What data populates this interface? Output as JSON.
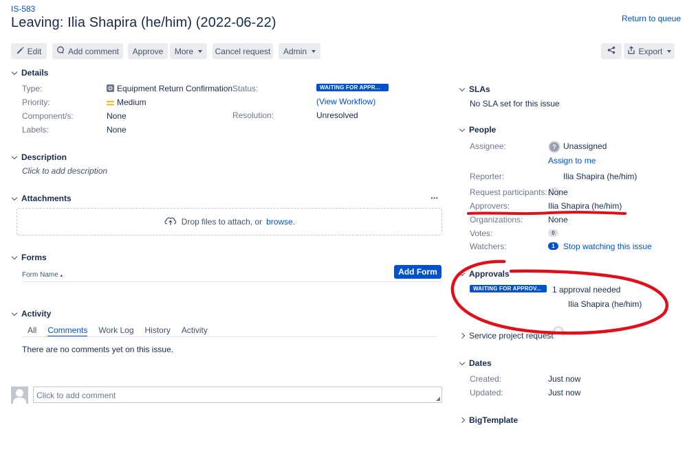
{
  "header": {
    "issue_key": "IS-583",
    "title": "Leaving: Ilia Shapira (he/him) (2022-06-22)",
    "return_link": "Return to queue"
  },
  "toolbar": {
    "edit": "Edit",
    "add_comment": "Add comment",
    "approve": "Approve",
    "more": "More",
    "cancel_request": "Cancel request",
    "admin": "Admin",
    "export": "Export"
  },
  "details": {
    "heading": "Details",
    "type_label": "Type:",
    "type_value": "Equipment Return Confirmation",
    "priority_label": "Priority:",
    "priority_value": "Medium",
    "components_label": "Component/s:",
    "components_value": "None",
    "labels_label": "Labels:",
    "labels_value": "None",
    "status_label": "Status:",
    "status_value": "WAITING FOR APPR...",
    "view_workflow": "(View Workflow)",
    "resolution_label": "Resolution:",
    "resolution_value": "Unresolved"
  },
  "description": {
    "heading": "Description",
    "placeholder": "Click to add description"
  },
  "attachments": {
    "heading": "Attachments",
    "more": "···",
    "drop_text": "Drop files to attach, or",
    "browse": "browse."
  },
  "forms": {
    "heading": "Forms",
    "form_name": "Form Name",
    "add_form": "Add Form"
  },
  "activity": {
    "heading": "Activity",
    "tabs": [
      "All",
      "Comments",
      "Work Log",
      "History",
      "Activity"
    ],
    "active_tab": "Comments",
    "empty": "There are no comments yet on this issue.",
    "comment_placeholder": "Click to add comment"
  },
  "slas": {
    "heading": "SLAs",
    "text": "No SLA set for this issue"
  },
  "people": {
    "heading": "People",
    "assignee_label": "Assignee:",
    "assignee_value": "Unassigned",
    "assign_to_me": "Assign to me",
    "reporter_label": "Reporter:",
    "reporter_value": "Ilia Shapira (he/him)",
    "participants_label": "Request participants:",
    "participants_value": "None",
    "approvers_label": "Approvers:",
    "approvers_value": "Ilia Shapira (he/him)",
    "organizations_label": "Organizations:",
    "organizations_value": "None",
    "votes_label": "Votes:",
    "votes_value": "0",
    "watchers_label": "Watchers:",
    "watchers_count": "1",
    "watchers_link": "Stop watching this issue"
  },
  "approvals": {
    "heading": "Approvals",
    "status": "WAITING FOR APPROV...",
    "needed": "1 approval needed",
    "approver": "Ilia Shapira (he/him)"
  },
  "service_request": {
    "heading": "Service project request"
  },
  "dates": {
    "heading": "Dates",
    "created_label": "Created:",
    "created_value": "Just now",
    "updated_label": "Updated:",
    "updated_value": "Just now"
  },
  "bigtemplate": {
    "heading": "BigTemplate"
  },
  "colors": {
    "primary": "#0052cc",
    "annotation": "#e0101a",
    "text": "#172b4d",
    "muted": "#6b778c",
    "button_bg": "#ebecf0"
  },
  "icons": [
    "pencil-icon",
    "comment-icon",
    "share-icon",
    "export-icon",
    "chevron-down-icon",
    "cloud-upload-icon",
    "equipment-type-icon",
    "priority-medium-icon",
    "unassigned-icon",
    "avatar"
  ]
}
